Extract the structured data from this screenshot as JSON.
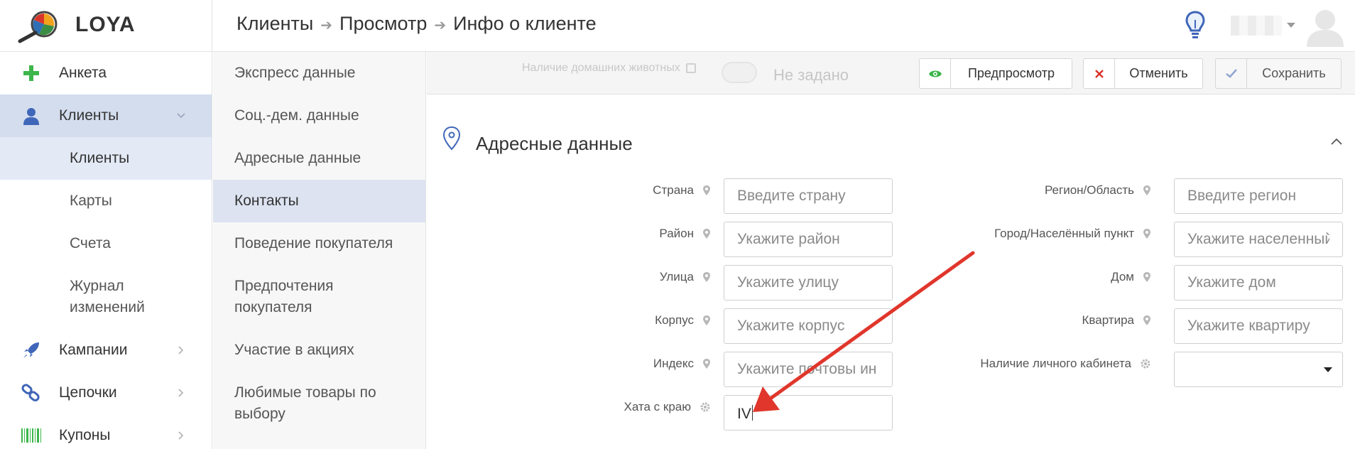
{
  "app": {
    "name": "LOYA"
  },
  "breadcrumb": [
    "Клиенты",
    "Просмотр",
    "Инфо о клиенте"
  ],
  "sidebar": {
    "items": [
      {
        "label": "Анкета",
        "icon": "plus-icon"
      },
      {
        "label": "Клиенты",
        "icon": "user-icon",
        "expanded": true
      },
      {
        "label": "Клиенты",
        "sub": true,
        "active": true
      },
      {
        "label": "Карты",
        "sub": true
      },
      {
        "label": "Счета",
        "sub": true
      },
      {
        "label": "Журнал изменений",
        "sub": true
      },
      {
        "label": "Кампании",
        "icon": "rocket-icon"
      },
      {
        "label": "Цепочки",
        "icon": "chain-icon"
      },
      {
        "label": "Купоны",
        "icon": "barcode-icon"
      }
    ]
  },
  "submenu": {
    "items": [
      {
        "label": "Экспресс данные"
      },
      {
        "label": "Соц.-дем. данные"
      },
      {
        "label": "Адресные данные"
      },
      {
        "label": "Контакты",
        "active": true
      },
      {
        "label": "Поведение покупателя"
      },
      {
        "label": "Предпочтения покупателя"
      },
      {
        "label": "Участие в акциях"
      },
      {
        "label": "Любимые товары по выбору"
      }
    ]
  },
  "toolbar": {
    "faded_field_label": "Наличие домашних животных",
    "faded_field_value": "Не задано",
    "preview_label": "Предпросмотр",
    "cancel_label": "Отменить",
    "save_label": "Сохранить"
  },
  "section": {
    "title": "Адресные данные",
    "left_fields": [
      {
        "label": "Страна",
        "placeholder": "Введите страну",
        "value": "",
        "icon": "map-pin-icon"
      },
      {
        "label": "Район",
        "placeholder": "Укажите район",
        "value": "",
        "icon": "map-pin-icon"
      },
      {
        "label": "Улица",
        "placeholder": "Укажите улицу",
        "value": "",
        "icon": "map-pin-icon"
      },
      {
        "label": "Корпус",
        "placeholder": "Укажите корпус",
        "value": "",
        "icon": "map-pin-icon"
      },
      {
        "label": "Индекс",
        "placeholder": "Укажите почтовы ин",
        "value": "",
        "icon": "map-pin-icon"
      },
      {
        "label": "Хата с краю",
        "placeholder": "",
        "value": "IV",
        "icon": "gear-icon"
      }
    ],
    "right_fields": [
      {
        "label": "Регион/Область",
        "placeholder": "Введите регион",
        "icon": "map-pin-icon"
      },
      {
        "label": "Город/Населённый пункт",
        "placeholder": "Укажите населенный",
        "icon": "map-pin-icon"
      },
      {
        "label": "Дом",
        "placeholder": "Укажите дом",
        "icon": "map-pin-icon"
      },
      {
        "label": "Квартира",
        "placeholder": "Укажите квартиру",
        "icon": "map-pin-icon"
      },
      {
        "label": "Наличие личного кабинета",
        "placeholder": "",
        "icon": "gear-icon",
        "type": "select"
      }
    ]
  },
  "colors": {
    "accent": "#3f66b8",
    "sidebar_active": "#d4ddee",
    "annotation_arrow": "#e0362c",
    "eye_green": "#3cb64a",
    "cancel_red": "#d9342b"
  }
}
